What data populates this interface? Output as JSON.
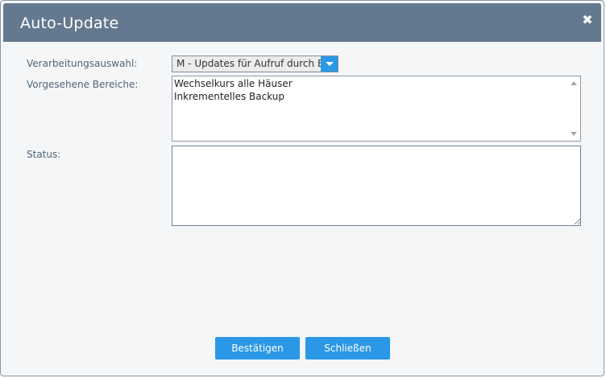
{
  "dialog": {
    "title": "Auto-Update",
    "close_symbol": "✖"
  },
  "form": {
    "processing_label": "Verarbeitungsauswahl:",
    "processing_value": "M - Updates für Aufruf durch Benutzer",
    "areas_label": "Vorgesehene Bereiche:",
    "areas": [
      "Wechselkurs alle Häuser",
      "Inkrementelles Backup"
    ],
    "status_label": "Status:",
    "status_value": ""
  },
  "buttons": {
    "confirm_label": "Bestätigen",
    "close_label": "Schließen"
  },
  "colors": {
    "titlebar": "#64798f",
    "accent": "#2a98e6",
    "label": "#4f6478"
  }
}
